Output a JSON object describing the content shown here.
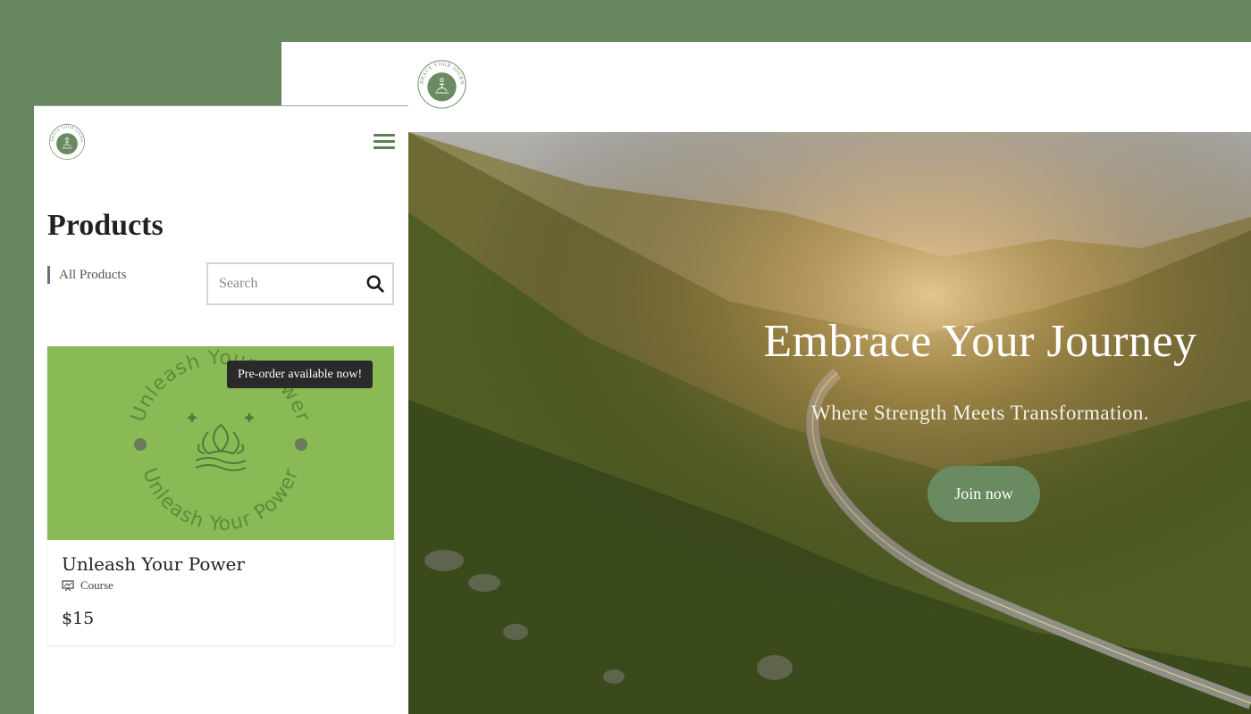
{
  "colors": {
    "backdrop": "#67875f",
    "brand_green": "#6a8a62",
    "card_image_bg": "#8aba55",
    "badge_bg": "#2a2a2a"
  },
  "logo": {
    "ring_text": "EMBRACE YOUR JOURNEY",
    "icon": "meditation-lotus-icon"
  },
  "desktop": {
    "hero": {
      "title": "Embrace Your Journey",
      "subtitle": "Where Strength Meets Transformation.",
      "cta_label": "Join now"
    }
  },
  "mobile": {
    "menu_icon": "hamburger-menu-icon",
    "page_title": "Products",
    "filter_label": "All Products",
    "search": {
      "placeholder": "Search",
      "icon": "search-icon"
    },
    "product": {
      "badge": "Pre-order available now!",
      "image_ring_text": "Unleash Your Power",
      "title": "Unleash Your Power",
      "type": "Course",
      "type_icon": "course-presentation-icon",
      "price": "$15"
    }
  }
}
